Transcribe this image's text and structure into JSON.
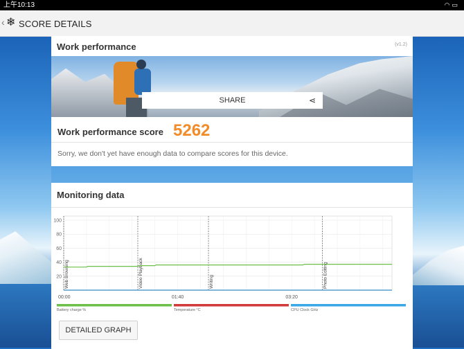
{
  "status_bar": {
    "time": "上午10:13",
    "icons": [
      "wifi-icon",
      "battery-icon"
    ]
  },
  "app_bar": {
    "title": "SCORE DETAILS",
    "back_icon": "chevron-left-icon",
    "logo_icon": "snowflake-logo-icon"
  },
  "work_card": {
    "title": "Work performance",
    "version": "(v1.2)",
    "share_label": "SHARE",
    "score_label": "Work performance score",
    "score_value": "5262",
    "note": "Sorry, we don't yet have enough data to compare scores for this device."
  },
  "monitoring_card": {
    "title": "Monitoring data",
    "detailed_graph_label": "DETAILED GRAPH"
  },
  "chart_data": {
    "type": "line",
    "y_ticks": [
      "100",
      "80",
      "60",
      "40",
      "20"
    ],
    "ylim": [
      0,
      100
    ],
    "x_ticks": [
      {
        "label": "00:00",
        "t": 0
      },
      {
        "label": "01:40",
        "t": 100
      },
      {
        "label": "03:20",
        "t": 200
      }
    ],
    "xlim": [
      0,
      288
    ],
    "events": [
      {
        "label": "Web Browsing",
        "t": 0
      },
      {
        "label": "Video Playback",
        "t": 65
      },
      {
        "label": "Writing",
        "t": 127
      },
      {
        "label": "Photo Editing",
        "t": 227
      }
    ],
    "series": [
      {
        "name": "Battery charge %",
        "color": "#6cc04a",
        "x": [
          0,
          20,
          21,
          65,
          66,
          80,
          81,
          210,
          211,
          288
        ],
        "y": [
          33,
          33,
          34,
          34,
          35,
          35,
          36,
          36,
          37,
          37
        ]
      },
      {
        "name": "Temperature °C",
        "color": "#d23a3a",
        "x": [
          0,
          288
        ],
        "y": [
          0,
          0
        ]
      },
      {
        "name": "CPU Clock GHz",
        "color": "#3aa7e6",
        "x": [
          0,
          288
        ],
        "y": [
          0,
          0
        ]
      }
    ],
    "grid": true
  },
  "colors": {
    "score": "#f28c28",
    "battery": "#6cc04a",
    "temperature": "#d23a3a",
    "cpu": "#3aa7e6"
  }
}
